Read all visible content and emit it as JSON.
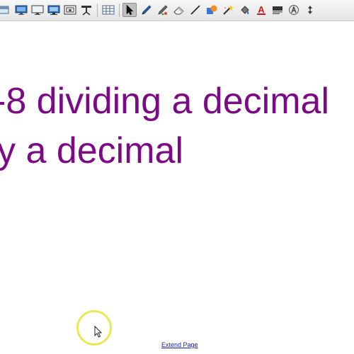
{
  "toolbar": {
    "tools": [
      {
        "icon": "screen-shade-icon",
        "selected": false
      },
      {
        "icon": "display-icon",
        "selected": false
      },
      {
        "icon": "monitor-icon",
        "selected": false
      },
      {
        "icon": "dual-monitor-icon",
        "selected": false
      },
      {
        "icon": "capture-icon",
        "selected": false
      },
      {
        "icon": "projector-icon",
        "selected": false
      },
      {
        "icon": "table-icon",
        "selected": false
      },
      {
        "icon": "select-arrow-icon",
        "selected": true
      },
      {
        "icon": "pen-icon",
        "selected": false
      },
      {
        "icon": "creative-pen-icon",
        "selected": false
      },
      {
        "icon": "eraser-icon",
        "selected": false
      },
      {
        "icon": "line-icon",
        "selected": false
      },
      {
        "icon": "shapes-icon",
        "selected": false
      },
      {
        "icon": "magic-pen-icon",
        "selected": false
      },
      {
        "icon": "fill-icon",
        "selected": false
      },
      {
        "icon": "text-icon",
        "selected": false
      },
      {
        "icon": "text-style-icon",
        "selected": false
      },
      {
        "icon": "properties-icon",
        "selected": false
      },
      {
        "icon": "move-toolbar-icon",
        "selected": false
      }
    ],
    "text_tool_letter": "A"
  },
  "content": {
    "title_line_1": "-8 dividing a decimal",
    "title_line_2": "y a decimal",
    "color": "#7b0a84"
  },
  "footer": {
    "extend_page_link": "Extend Page"
  },
  "colors": {
    "title_text": "#7b0a84",
    "link": "#1a1ac8",
    "cursor_highlight": "#e8e858",
    "toolbar_background": "#e9e9e9"
  }
}
